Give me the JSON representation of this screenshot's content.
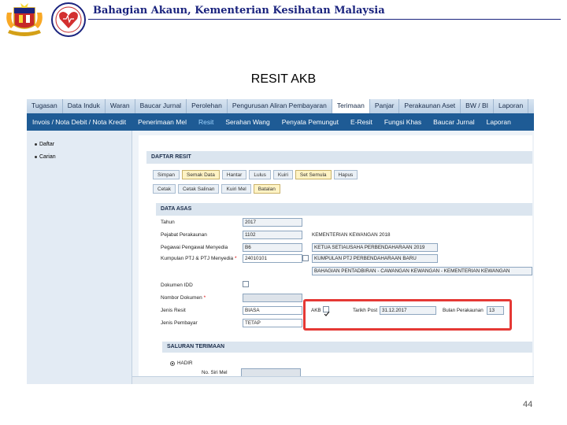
{
  "slide": {
    "title": "Bahagian Akaun, Kementerian Kesihatan Malaysia",
    "heading": "RESIT AKB",
    "page_number": "44"
  },
  "menu_primary": [
    {
      "label": "Tugasan",
      "active": false
    },
    {
      "label": "Data Induk",
      "active": false
    },
    {
      "label": "Waran",
      "active": false
    },
    {
      "label": "Baucar Jurnal",
      "active": false
    },
    {
      "label": "Perolehan",
      "active": false
    },
    {
      "label": "Pengurusan Aliran Pembayaran",
      "active": false
    },
    {
      "label": "Terimaan",
      "active": true
    },
    {
      "label": "Panjar",
      "active": false
    },
    {
      "label": "Perakaunan Aset",
      "active": false
    },
    {
      "label": "BW / BI",
      "active": false
    },
    {
      "label": "Laporan",
      "active": false
    }
  ],
  "menu_secondary": [
    {
      "label": "Invois / Nota Debit / Nota Kredit",
      "active": false
    },
    {
      "label": "Penerimaan Mel",
      "active": false
    },
    {
      "label": "Resit",
      "active": true
    },
    {
      "label": "Serahan Wang",
      "active": false
    },
    {
      "label": "Penyata Pemungut",
      "active": false
    },
    {
      "label": "E-Resit",
      "active": false
    },
    {
      "label": "Fungsi Khas",
      "active": false
    },
    {
      "label": "Baucar Jurnal",
      "active": false
    },
    {
      "label": "Laporan",
      "active": false
    }
  ],
  "sidebar": {
    "items": [
      "Daftar",
      "Carian"
    ]
  },
  "panel": {
    "title": "DAFTAR RESIT",
    "toolbar1": [
      "Simpan",
      "Semak Data",
      "Hantar",
      "Lulus",
      "Kuiri",
      "Set Semula",
      "Hapus"
    ],
    "toolbar2": [
      "Cetak",
      "Cetak Salinan",
      "Kuiri Mel",
      "Batalan"
    ]
  },
  "data_asas": {
    "title": "DATA ASAS",
    "tahun_label": "Tahun",
    "tahun_value": "2017",
    "pejabat_label": "Pejabat Perakaunan",
    "pejabat_value": "1102",
    "pejabat_desc": "KEMENTERIAN KEWANGAN 2018",
    "pegawai_label": "Pegawai Pengawal Menyedia",
    "pegawai_value": "B6",
    "pegawai_desc": "KETUA SETIAUSAHA PERBENDAHARAAN 2019",
    "ptj_label": "Kumpulan PTJ & PTJ Menyedia",
    "ptj_value": "24010101",
    "ptj_desc1": "KUMPULAN PTJ PERBENDAHARAAN BARU",
    "ptj_desc2": "BAHAGIAN PENTADBIRAN - CAWANGAN KEWANGAN - KEMENTERIAN KEWANGAN",
    "dokumen_id_label": "Dokumen IDD",
    "nombor_dokumen_label": "Nombor Dokumen",
    "jenis_resit_label": "Jenis Resit",
    "jenis_resit_value": "BIASA",
    "jenis_pembayar_label": "Jenis Pembayar",
    "jenis_pembayar_value": "TETAP",
    "akb_label": "AKB",
    "akb_checked": true,
    "tarikh_post_label": "Tarikh Post",
    "tarikh_post_value": "31.12.2017",
    "bulan_label": "Bulan Perakaunan",
    "bulan_value": "13"
  },
  "saluran": {
    "title": "SALURAN TERIMAAN",
    "option1": "HADIR",
    "no_siri_label": "No. Siri Mel"
  },
  "colors": {
    "menu_dark": "#1e5b95",
    "highlight_box": "#e53935"
  }
}
